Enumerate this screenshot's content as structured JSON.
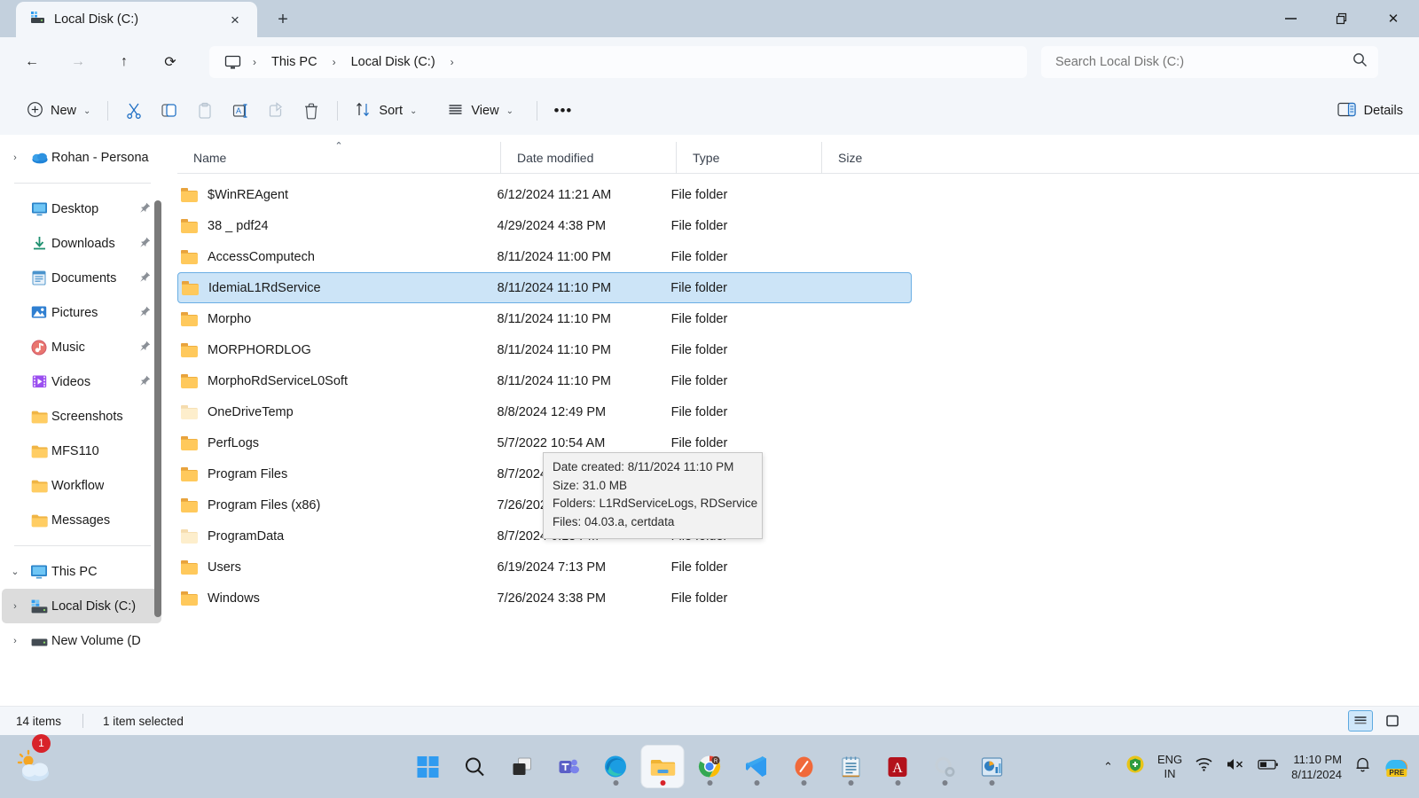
{
  "window": {
    "tab_title": "Local Disk (C:)",
    "tab_icon": "drive-icon",
    "close_tab_label": "×",
    "new_tab_label": "+",
    "minimize_label": "",
    "restore_label": "❐",
    "close_label": "✕"
  },
  "address": {
    "back_label": "←",
    "forward_label": "→",
    "up_label": "↑",
    "refresh_label": "⟳",
    "breadcrumbs": [
      {
        "label": "This PC"
      },
      {
        "label": "Local Disk (C:)"
      }
    ],
    "separator": "›"
  },
  "search": {
    "placeholder": "Search Local Disk (C:)",
    "value": "",
    "icon": "search-icon"
  },
  "toolbar": {
    "new_label": "New",
    "cut_label": "Cut",
    "copy_label": "Copy",
    "paste_label": "Paste",
    "rename_label": "Rename",
    "share_label": "Share",
    "delete_label": "Delete",
    "sort_label": "Sort",
    "view_label": "View",
    "more_label": "•••",
    "details_label": "Details",
    "chevron": "⌄"
  },
  "sidebar": {
    "items": [
      {
        "label": "Rohan - Persona",
        "icon": "onedrive-cloud-icon",
        "expander": "›",
        "pinned": false,
        "selected": false
      },
      {
        "label": "Desktop",
        "icon": "desktop-icon",
        "expander": "",
        "pinned": true,
        "selected": false
      },
      {
        "label": "Downloads",
        "icon": "downloads-icon",
        "expander": "",
        "pinned": true,
        "selected": false
      },
      {
        "label": "Documents",
        "icon": "documents-icon",
        "expander": "",
        "pinned": true,
        "selected": false
      },
      {
        "label": "Pictures",
        "icon": "pictures-icon",
        "expander": "",
        "pinned": true,
        "selected": false
      },
      {
        "label": "Music",
        "icon": "music-icon",
        "expander": "",
        "pinned": true,
        "selected": false
      },
      {
        "label": "Videos",
        "icon": "videos-icon",
        "expander": "",
        "pinned": true,
        "selected": false
      },
      {
        "label": "Screenshots",
        "icon": "folder-icon",
        "expander": "",
        "pinned": false,
        "selected": false
      },
      {
        "label": "MFS110",
        "icon": "folder-icon",
        "expander": "",
        "pinned": false,
        "selected": false
      },
      {
        "label": "Workflow",
        "icon": "folder-icon",
        "expander": "",
        "pinned": false,
        "selected": false
      },
      {
        "label": "Messages",
        "icon": "folder-icon",
        "expander": "",
        "pinned": false,
        "selected": false
      },
      {
        "label": "This PC",
        "icon": "thispc-icon",
        "expander": "⌄",
        "pinned": false,
        "selected": false
      },
      {
        "label": "Local Disk (C:)",
        "icon": "drive-icon",
        "expander": "›",
        "pinned": false,
        "selected": true
      },
      {
        "label": "New Volume (D",
        "icon": "drive-plain-icon",
        "expander": "›",
        "pinned": false,
        "selected": false
      }
    ]
  },
  "filelist": {
    "columns": [
      {
        "label": "Name",
        "sorted": true,
        "sort_caret": "⌃"
      },
      {
        "label": "Date modified",
        "sorted": false,
        "sort_caret": ""
      },
      {
        "label": "Type",
        "sorted": false,
        "sort_caret": ""
      },
      {
        "label": "Size",
        "sorted": false,
        "sort_caret": ""
      }
    ],
    "rows": [
      {
        "name": "$WinREAgent",
        "date": "6/12/2024 11:21 AM",
        "type": "File folder",
        "size": "",
        "selected": false,
        "faded": false
      },
      {
        "name": "38 _ pdf24",
        "date": "4/29/2024 4:38 PM",
        "type": "File folder",
        "size": "",
        "selected": false,
        "faded": false
      },
      {
        "name": "AccessComputech",
        "date": "8/11/2024 11:00 PM",
        "type": "File folder",
        "size": "",
        "selected": false,
        "faded": false
      },
      {
        "name": "IdemiaL1RdService",
        "date": "8/11/2024 11:10 PM",
        "type": "File folder",
        "size": "",
        "selected": true,
        "faded": false
      },
      {
        "name": "Morpho",
        "date": "8/11/2024 11:10 PM",
        "type": "File folder",
        "size": "",
        "selected": false,
        "faded": false
      },
      {
        "name": "MORPHORDLOG",
        "date": "8/11/2024 11:10 PM",
        "type": "File folder",
        "size": "",
        "selected": false,
        "faded": false
      },
      {
        "name": "MorphoRdServiceL0Soft",
        "date": "8/11/2024 11:10 PM",
        "type": "File folder",
        "size": "",
        "selected": false,
        "faded": false
      },
      {
        "name": "OneDriveTemp",
        "date": "8/8/2024 12:49 PM",
        "type": "File folder",
        "size": "",
        "selected": false,
        "faded": true
      },
      {
        "name": "PerfLogs",
        "date": "5/7/2022 10:54 AM",
        "type": "File folder",
        "size": "",
        "selected": false,
        "faded": false
      },
      {
        "name": "Program Files",
        "date": "8/7/2024 6:15 PM",
        "type": "File folder",
        "size": "",
        "selected": false,
        "faded": false
      },
      {
        "name": "Program Files (x86)",
        "date": "7/26/2024 3:38 PM",
        "type": "File folder",
        "size": "",
        "selected": false,
        "faded": false
      },
      {
        "name": "ProgramData",
        "date": "8/7/2024 6:18 PM",
        "type": "File folder",
        "size": "",
        "selected": false,
        "faded": true
      },
      {
        "name": "Users",
        "date": "6/19/2024 7:13 PM",
        "type": "File folder",
        "size": "",
        "selected": false,
        "faded": false
      },
      {
        "name": "Windows",
        "date": "7/26/2024 3:38 PM",
        "type": "File folder",
        "size": "",
        "selected": false,
        "faded": false
      }
    ]
  },
  "tooltip": {
    "date_created": "Date created: 8/11/2024 11:10 PM",
    "size": "Size: 31.0 MB",
    "folders": "Folders: L1RdServiceLogs, RDService",
    "files": "Files: 04.03.a, certdata"
  },
  "statusbar": {
    "item_count": "14 items",
    "selection": "1 item selected",
    "details_view_label": "Details view",
    "large_icons_label": "Large icons view"
  },
  "taskbar": {
    "weather_badge": "1",
    "apps": [
      {
        "name": "start-button",
        "running": false
      },
      {
        "name": "search-button",
        "running": false
      },
      {
        "name": "task-view-button",
        "running": false
      },
      {
        "name": "teams-app",
        "running": false
      },
      {
        "name": "edge-browser",
        "running": true
      },
      {
        "name": "file-explorer",
        "running": true,
        "active": true
      },
      {
        "name": "chrome-browser",
        "running": true
      },
      {
        "name": "vscode-app",
        "running": true
      },
      {
        "name": "editor-app",
        "running": true
      },
      {
        "name": "notepad-app",
        "running": true
      },
      {
        "name": "acrobat-reader",
        "running": true
      },
      {
        "name": "settings-app",
        "running": true
      },
      {
        "name": "charts-app",
        "running": true
      }
    ],
    "tray": {
      "overflow": "⌃",
      "language_primary": "ENG",
      "language_secondary": "IN",
      "time": "11:10 PM",
      "date": "8/11/2024",
      "copilot_badge": "PRE"
    }
  },
  "colors": {
    "accent": "#0f6cbd",
    "titlebar": "#c3d0dd",
    "chrome": "#f3f6fa",
    "selection": "#cce4f7",
    "selection_border": "#6aaee4",
    "folder": "#ffc95c"
  }
}
